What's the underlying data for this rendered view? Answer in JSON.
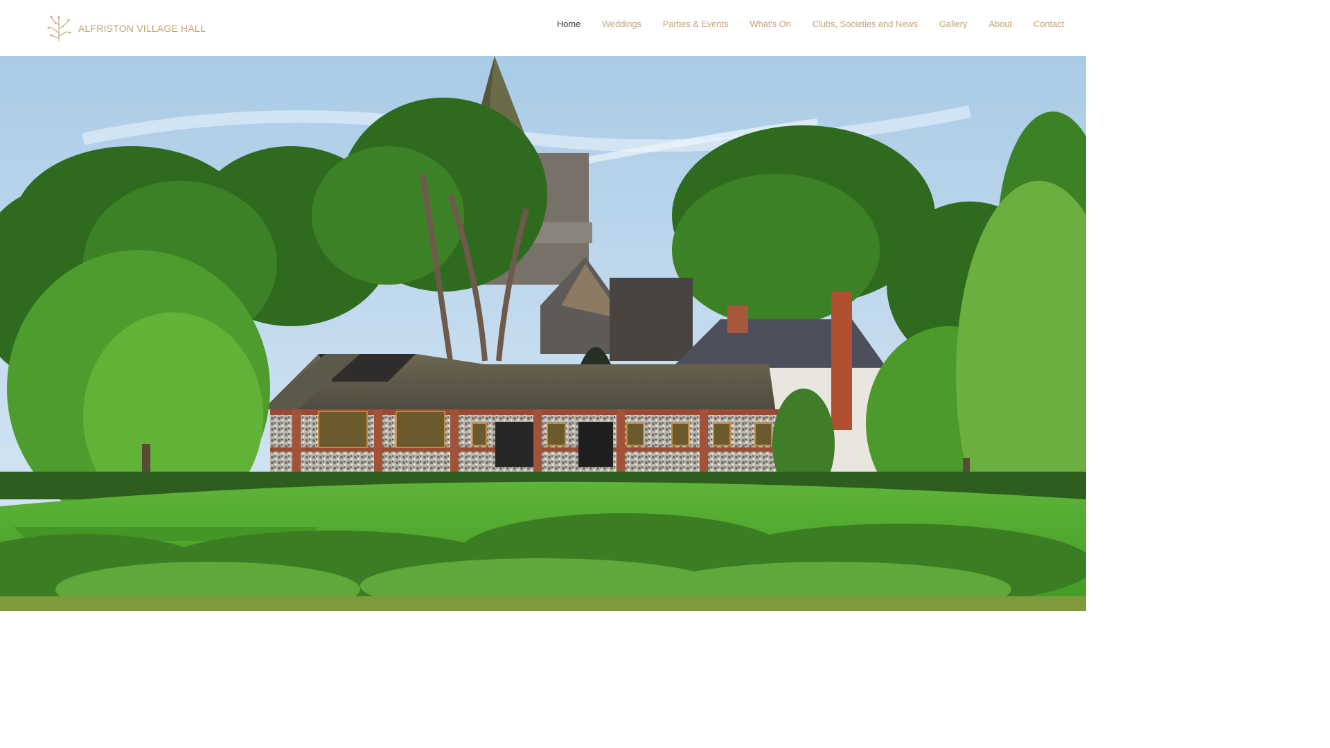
{
  "site": {
    "title": "ALFRISTON VILLAGE HALL",
    "logo_icon": "tree-icon"
  },
  "nav": {
    "items": [
      {
        "label": "Home",
        "active": true
      },
      {
        "label": "Weddings",
        "active": false
      },
      {
        "label": "Parties & Events",
        "active": false
      },
      {
        "label": "What's On",
        "active": false
      },
      {
        "label": "Clubs, Societies and News",
        "active": false
      },
      {
        "label": "Gallery",
        "active": false
      },
      {
        "label": "About",
        "active": false
      },
      {
        "label": "Contact",
        "active": false
      }
    ]
  },
  "colors": {
    "brand": "#c4a172",
    "nav_text": "#c6a478",
    "nav_active": "#3a3a3a"
  },
  "hero": {
    "image": "village-hall-with-church-spire-photo"
  }
}
